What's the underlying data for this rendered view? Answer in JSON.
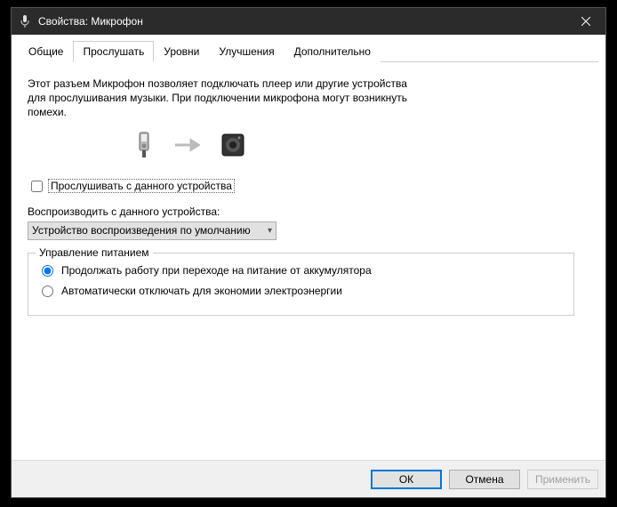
{
  "titlebar": {
    "title": "Свойства: Микрофон"
  },
  "tabs": {
    "general": "Общие",
    "listen": "Прослушать",
    "levels": "Уровни",
    "enhancements": "Улучшения",
    "advanced": "Дополнительно"
  },
  "panel": {
    "description": "Этот разъем Микрофон позволяет подключать плеер или другие устройства для прослушивания музыки. При подключении микрофона могут возникнуть помехи.",
    "listen_checkbox": "Прослушивать с данного устройства",
    "playback_label": "Воспроизводить с данного устройства:",
    "playback_selected": "Устройство воспроизведения по умолчанию",
    "power_legend": "Управление питанием",
    "power_continue": "Продолжать работу при переходе на питание от аккумулятора",
    "power_auto_off": "Автоматически отключать для экономии электроэнергии"
  },
  "footer": {
    "ok": "ОК",
    "cancel": "Отмена",
    "apply": "Применить"
  }
}
